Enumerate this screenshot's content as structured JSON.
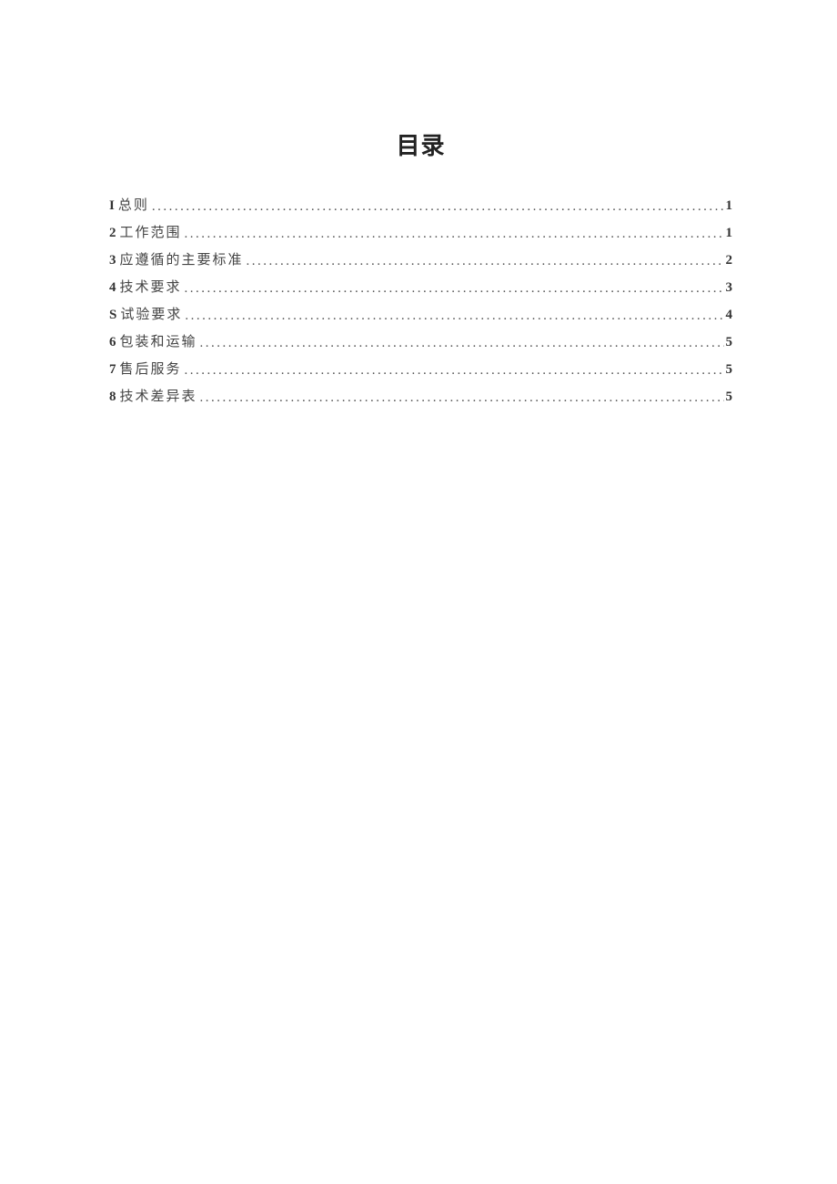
{
  "title": "目录",
  "toc": [
    {
      "num": "I",
      "label": "总则",
      "page": "1"
    },
    {
      "num": "2",
      "label": "工作范围",
      "page": "1"
    },
    {
      "num": "3",
      "label": "应遵循的主要标准",
      "page": "2"
    },
    {
      "num": "4",
      "label": "技术要求",
      "page": "3"
    },
    {
      "num": "S",
      "label": "试验要求",
      "page": "4"
    },
    {
      "num": "6",
      "label": "包装和运输",
      "page": "5"
    },
    {
      "num": "7",
      "label": "售后服务",
      "page": "5"
    },
    {
      "num": "8",
      "label": "技术差异表",
      "page": "5"
    }
  ]
}
